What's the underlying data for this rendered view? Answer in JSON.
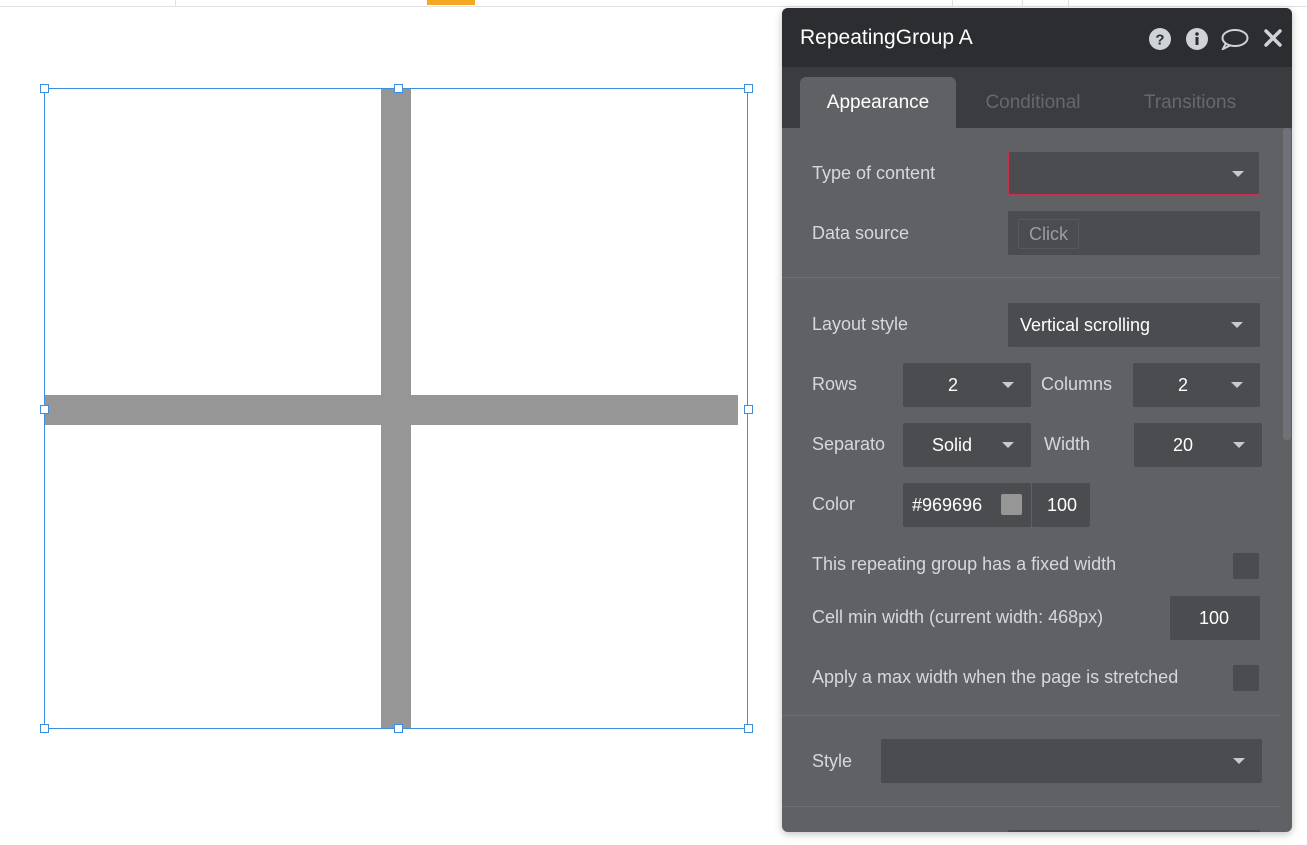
{
  "panel": {
    "title": "RepeatingGroup A",
    "tabs": [
      "Appearance",
      "Conditional",
      "Transitions"
    ],
    "header_icons": [
      "help-icon",
      "info-icon",
      "comment-icon",
      "close-icon"
    ]
  },
  "props": {
    "type_of_content": {
      "label": "Type of content",
      "value": ""
    },
    "data_source": {
      "label": "Data source",
      "value": "Click"
    },
    "layout_style": {
      "label": "Layout style",
      "value": "Vertical scrolling"
    },
    "rows": {
      "label": "Rows",
      "value": "2"
    },
    "columns": {
      "label": "Columns",
      "value": "2"
    },
    "separator": {
      "label": "Separato",
      "value": "Solid"
    },
    "width": {
      "label": "Width",
      "value": "20"
    },
    "color": {
      "label": "Color",
      "hex": "#969696",
      "opacity": "100"
    },
    "fixed_width": {
      "label": "This repeating group has a fixed width",
      "checked": false
    },
    "cell_min_width": {
      "label": "Cell min width (current width: 468px)",
      "value": "100"
    },
    "max_width": {
      "label": "Apply a max width when the page is stretched",
      "checked": false
    },
    "style": {
      "label": "Style",
      "value": ""
    }
  },
  "colors": {
    "separator": "#969696",
    "selection": "#3b8fe0",
    "error_border": "#c9304f",
    "accent": "#f5a623"
  }
}
